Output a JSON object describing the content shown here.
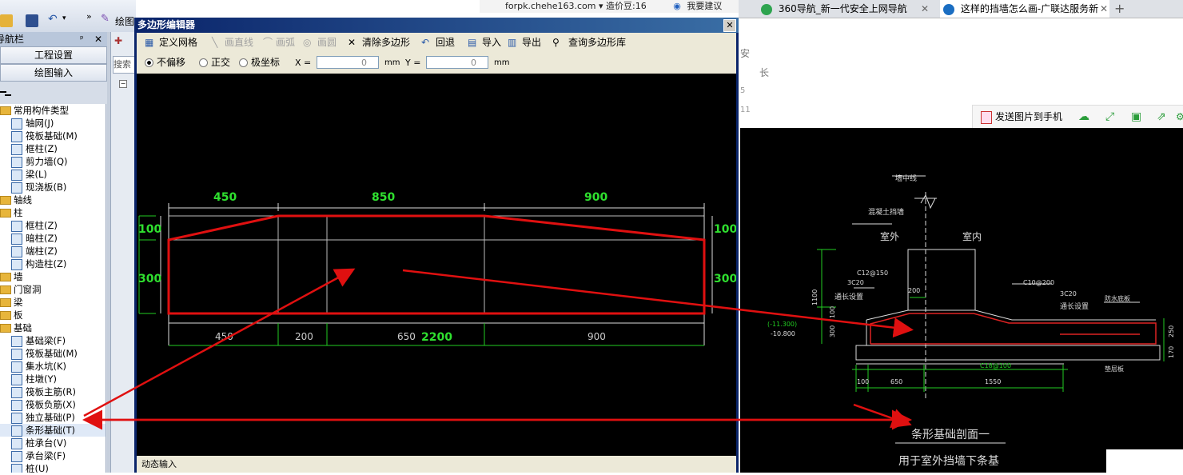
{
  "left_app": {
    "menu_label": "绘图",
    "nav_title": "导航栏",
    "pin_icon": "pin-icon",
    "close_icon": "close-icon",
    "btn_project": "工程设置",
    "btn_draw": "绘图输入",
    "search_placeholder": "搜索",
    "tree": [
      {
        "type": "folder",
        "label": "常用构件类型",
        "indent": 0
      },
      {
        "type": "item",
        "label": "轴网(J)",
        "indent": 1
      },
      {
        "type": "item",
        "label": "筏板基础(M)",
        "indent": 1
      },
      {
        "type": "item",
        "label": "框柱(Z)",
        "indent": 1
      },
      {
        "type": "item",
        "label": "剪力墙(Q)",
        "indent": 1
      },
      {
        "type": "item",
        "label": "梁(L)",
        "indent": 1
      },
      {
        "type": "item",
        "label": "现浇板(B)",
        "indent": 1
      },
      {
        "type": "folder",
        "label": "轴线",
        "indent": 0
      },
      {
        "type": "folder",
        "label": "柱",
        "indent": 0
      },
      {
        "type": "item",
        "label": "框柱(Z)",
        "indent": 1
      },
      {
        "type": "item",
        "label": "暗柱(Z)",
        "indent": 1
      },
      {
        "type": "item",
        "label": "端柱(Z)",
        "indent": 1
      },
      {
        "type": "item",
        "label": "构造柱(Z)",
        "indent": 1
      },
      {
        "type": "folder",
        "label": "墙",
        "indent": 0
      },
      {
        "type": "folder",
        "label": "门窗洞",
        "indent": 0
      },
      {
        "type": "folder",
        "label": "梁",
        "indent": 0
      },
      {
        "type": "folder",
        "label": "板",
        "indent": 0
      },
      {
        "type": "folder",
        "label": "基础",
        "indent": 0
      },
      {
        "type": "item",
        "label": "基础梁(F)",
        "indent": 1
      },
      {
        "type": "item",
        "label": "筏板基础(M)",
        "indent": 1
      },
      {
        "type": "item",
        "label": "集水坑(K)",
        "indent": 1
      },
      {
        "type": "item",
        "label": "柱墩(Y)",
        "indent": 1
      },
      {
        "type": "item",
        "label": "筏板主筋(R)",
        "indent": 1
      },
      {
        "type": "item",
        "label": "筏板负筋(X)",
        "indent": 1
      },
      {
        "type": "item",
        "label": "独立基础(P)",
        "indent": 1
      },
      {
        "type": "item",
        "label": "条形基础(T)",
        "indent": 1,
        "selected": true
      },
      {
        "type": "item",
        "label": "桩承台(V)",
        "indent": 1
      },
      {
        "type": "item",
        "label": "承台梁(F)",
        "indent": 1
      },
      {
        "type": "item",
        "label": "桩(U)",
        "indent": 1
      }
    ]
  },
  "dialog": {
    "title": "多边形编辑器",
    "toolbar1": {
      "define_grid": "定义网格",
      "draw_line": "画直线",
      "draw_arc": "画弧",
      "draw_circle": "画圆",
      "clear_polygon": "清除多边形",
      "undo": "回退",
      "import": "导入",
      "export": "导出",
      "query_library": "查询多边形库"
    },
    "toolbar2": {
      "no_offset": "不偏移",
      "orthogonal": "正交",
      "polar": "极坐标",
      "x_label": "X =",
      "x_value": "0",
      "y_label": "Y =",
      "y_value": "0",
      "unit": "mm"
    },
    "status": "动态输入",
    "drawing": {
      "top_dims": [
        "450",
        "850",
        "900"
      ],
      "bottom_dims": [
        "450",
        "200",
        "650",
        "900"
      ],
      "total": "2200",
      "left_dims": [
        "100",
        "300"
      ],
      "right_dims": [
        "100",
        "300"
      ]
    }
  },
  "browser": {
    "top_strip_text": "forpk.chehe163.com ▾ 造价豆:16",
    "suggest_label": "我要建议",
    "tabs": [
      {
        "label": "360导航_新一代安全上网导航",
        "active": false
      },
      {
        "label": "这样的挡墙怎么画-广联达服务新",
        "active": true
      }
    ],
    "new_tab": "+",
    "partial_chars": [
      "安",
      "长",
      "5",
      "11"
    ],
    "send_to_phone": "发送图片到手机"
  },
  "cad_image": {
    "wall_center": "墙中线",
    "concrete_wall": "混凝土挡墙",
    "outside": "室外",
    "inside": "室内",
    "rebar_left": "C12@150",
    "rebar_left2": "3C20",
    "through_left": "通长设置",
    "rebar_right": "C10@200",
    "rebar_right2": "3C20",
    "through_right": "通长设置",
    "waterproof": "防水底板",
    "dim_1100": "1100",
    "dim_100": "100",
    "dim_300": "300",
    "dim_200": "200",
    "elev1": "(-11.300)",
    "elev2": "-10.800",
    "bottom_rebar": "C18@100",
    "cushion": "垫层板",
    "dim_b100": "100",
    "dim_650": "650",
    "dim_1550": "1550",
    "dim_250": "250",
    "dim_170": "170",
    "caption1": "条形基础剖面一",
    "caption2": "用于室外挡墙下条基"
  }
}
